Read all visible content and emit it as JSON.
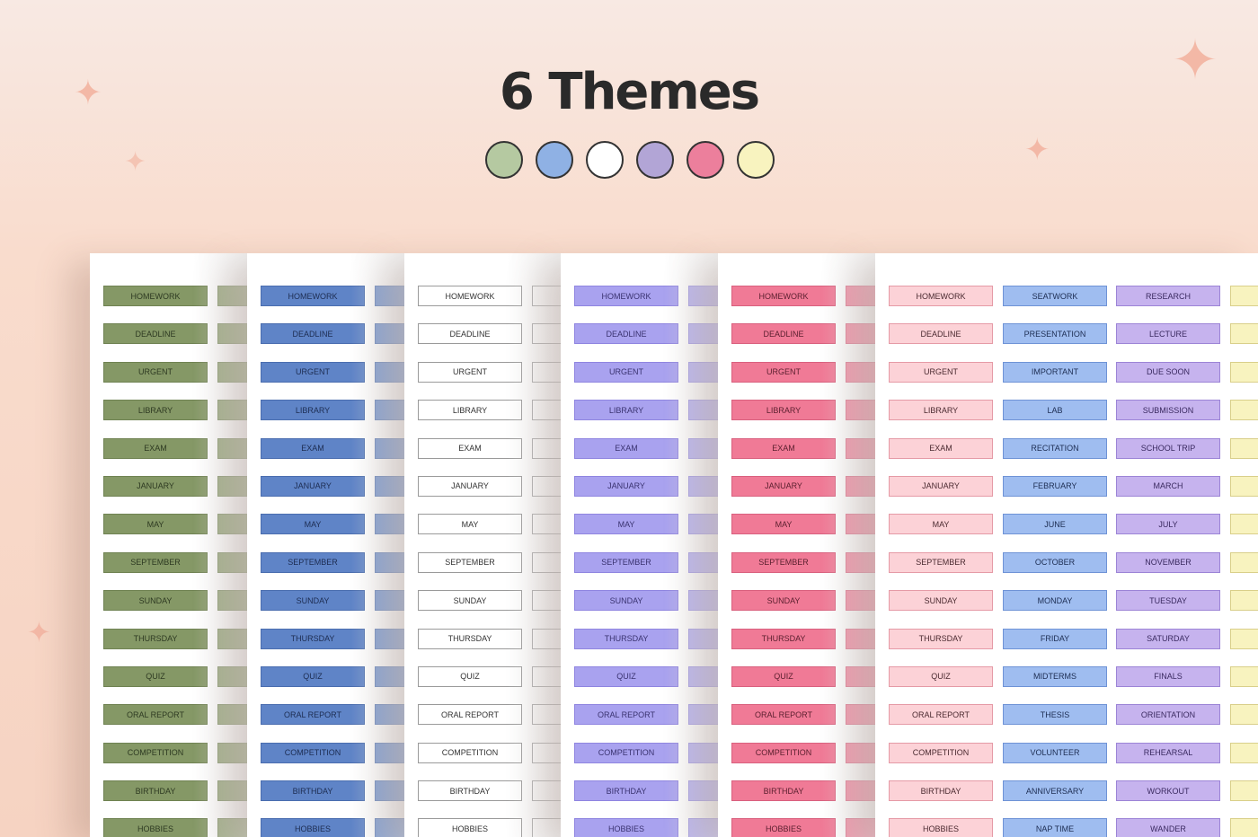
{
  "title": "6 Themes",
  "themes": [
    {
      "name": "green",
      "color": "#b5c9a1"
    },
    {
      "name": "blue",
      "color": "#8fb1e4"
    },
    {
      "name": "white",
      "color": "#ffffff"
    },
    {
      "name": "purple",
      "color": "#b2a5d6"
    },
    {
      "name": "pink",
      "color": "#ec7f9c"
    },
    {
      "name": "yellow",
      "color": "#f8f3bf"
    }
  ],
  "sheets": [
    {
      "theme": "green",
      "bg": "#859866",
      "border": "#6f8252",
      "text": "#2e3a22",
      "cols": [
        [
          "HOMEWORK",
          "DEADLINE",
          "URGENT",
          "LIBRARY",
          "EXAM",
          "JANUARY",
          "MAY",
          "SEPTEMBER",
          "SUNDAY",
          "THURSDAY",
          "QUIZ",
          "ORAL REPORT",
          "COMPETITION",
          "BIRTHDAY",
          "HOBBIES"
        ]
      ]
    },
    {
      "theme": "blue",
      "bg": "#5f84c7",
      "border": "#4a6daf",
      "text": "#1d2d52",
      "cols": [
        [
          "HOMEWORK",
          "DEADLINE",
          "URGENT",
          "LIBRARY",
          "EXAM",
          "JANUARY",
          "MAY",
          "SEPTEMBER",
          "SUNDAY",
          "THURSDAY",
          "QUIZ",
          "ORAL REPORT",
          "COMPETITION",
          "BIRTHDAY",
          "HOBBIES"
        ]
      ]
    },
    {
      "theme": "white",
      "bg": "#ffffff",
      "border": "#9a9a9a",
      "text": "#333333",
      "cols": [
        [
          "HOMEWORK",
          "DEADLINE",
          "URGENT",
          "LIBRARY",
          "EXAM",
          "JANUARY",
          "MAY",
          "SEPTEMBER",
          "SUNDAY",
          "THURSDAY",
          "QUIZ",
          "ORAL REPORT",
          "COMPETITION",
          "BIRTHDAY",
          "HOBBIES"
        ]
      ]
    },
    {
      "theme": "purple",
      "bg": "#a9a2ef",
      "border": "#8f85e0",
      "text": "#3a3370",
      "cols": [
        [
          "HOMEWORK",
          "DEADLINE",
          "URGENT",
          "LIBRARY",
          "EXAM",
          "JANUARY",
          "MAY",
          "SEPTEMBER",
          "SUNDAY",
          "THURSDAY",
          "QUIZ",
          "ORAL REPORT",
          "COMPETITION",
          "BIRTHDAY",
          "HOBBIES"
        ]
      ]
    },
    {
      "theme": "pink",
      "bg": "#f07a96",
      "border": "#d9607e",
      "text": "#5a1f2e",
      "cols": [
        [
          "HOMEWORK",
          "DEADLINE",
          "URGENT",
          "LIBRARY",
          "EXAM",
          "JANUARY",
          "MAY",
          "SEPTEMBER",
          "SUNDAY",
          "THURSDAY",
          "QUIZ",
          "ORAL REPORT",
          "COMPETITION",
          "BIRTHDAY",
          "HOBBIES"
        ]
      ]
    },
    {
      "theme": "pastel",
      "bg": "#fcd2d7",
      "border": "#e59aa6",
      "text": "#4a2a30",
      "cols": [
        [
          "HOMEWORK",
          "DEADLINE",
          "URGENT",
          "LIBRARY",
          "EXAM",
          "JANUARY",
          "MAY",
          "SEPTEMBER",
          "SUNDAY",
          "THURSDAY",
          "QUIZ",
          "ORAL REPORT",
          "COMPETITION",
          "BIRTHDAY",
          "HOBBIES"
        ],
        [
          "SEATWORK",
          "PRESENTATION",
          "IMPORTANT",
          "LAB",
          "RECITATION",
          "FEBRUARY",
          "JUNE",
          "OCTOBER",
          "MONDAY",
          "FRIDAY",
          "MIDTERMS",
          "THESIS",
          "VOLUNTEER",
          "ANNIVERSARY",
          "NAP TIME"
        ],
        [
          "RESEARCH",
          "LECTURE",
          "DUE SOON",
          "SUBMISSION",
          "SCHOOL TRIP",
          "MARCH",
          "JULY",
          "NOVEMBER",
          "TUESDAY",
          "SATURDAY",
          "FINALS",
          "ORIENTATION",
          "REHEARSAL",
          "WORKOUT",
          "WANDER"
        ]
      ],
      "colBgs": [
        "#fcd2d7",
        "#9fbdf0",
        "#c6b3ee"
      ],
      "colBorders": [
        "#e59aa6",
        "#6f93d6",
        "#9c84d6"
      ],
      "colTexts": [
        "#4a2a30",
        "#1d2d52",
        "#3a2a60"
      ]
    }
  ]
}
